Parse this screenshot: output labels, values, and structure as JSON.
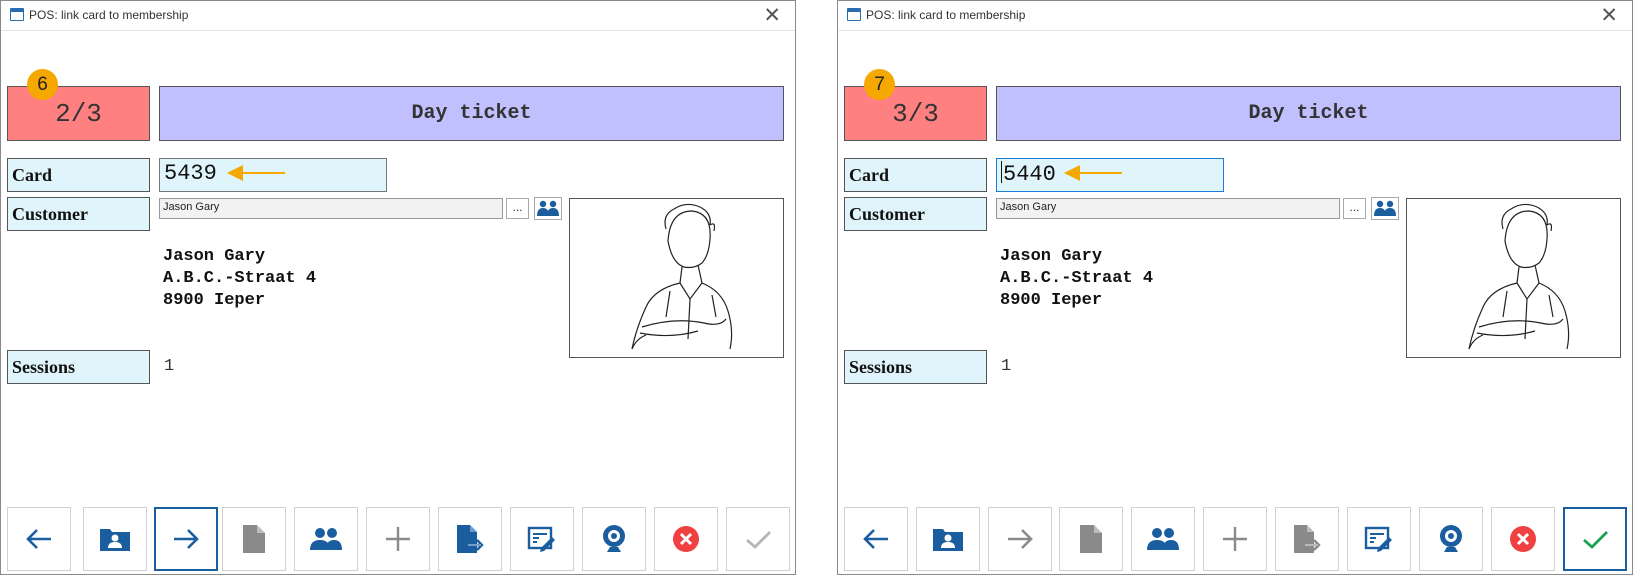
{
  "windows": [
    {
      "title": "POS: link card to membership",
      "step": "6",
      "counter": "2/3",
      "ticket_label": "Day ticket",
      "card_label": "Card",
      "card_value": "5439",
      "customer_label": "Customer",
      "customer_value": "Jason Gary",
      "more_label": "...",
      "address_name": "Jason Gary",
      "address_street": "A.B.C.-Straat 4",
      "address_city": "8900 Ieper",
      "sessions_label": "Sessions",
      "sessions_value": "1"
    },
    {
      "title": "POS: link card to membership",
      "step": "7",
      "counter": "3/3",
      "ticket_label": "Day ticket",
      "card_label": "Card",
      "card_value": "5440",
      "customer_label": "Customer",
      "customer_value": "Jason Gary",
      "more_label": "...",
      "address_name": "Jason Gary",
      "address_street": "A.B.C.-Straat 4",
      "address_city": "8900 Ieper",
      "sessions_label": "Sessions",
      "sessions_value": "1"
    }
  ],
  "icons": {
    "close": "close-icon",
    "arrow": "arrow-left-pointer-icon",
    "customer_search": "people-search-icon",
    "toolbar": [
      "arrow-left-icon",
      "contact-card-icon",
      "arrow-right-icon",
      "document-icon",
      "people-icon",
      "plus-icon",
      "document-export-icon",
      "form-edit-icon",
      "webcam-icon",
      "cancel-icon",
      "checkmark-icon"
    ]
  },
  "colors": {
    "counter_bg": "#ff8080",
    "ticket_bg": "#c0c0ff",
    "label_bg": "#e0f4fc",
    "step_badge": "#f5a800",
    "accent_blue": "#1a5ea0",
    "cancel_red": "#f04040",
    "confirm_green": "#16a34a"
  }
}
